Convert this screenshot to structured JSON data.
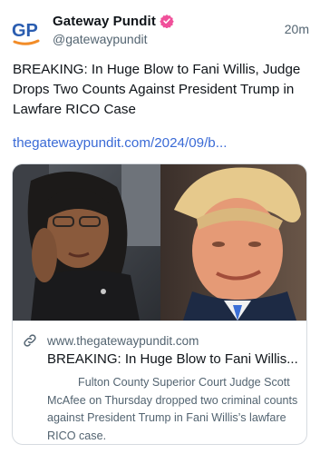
{
  "post": {
    "author_name": "Gateway Pundit",
    "author_handle": "@gatewaypundit",
    "avatar_text": "GP",
    "timestamp": "20m",
    "text": "BREAKING: In Huge Blow to Fani Willis, Judge Drops Two Counts Against President Trump in Lawfare RICO Case",
    "link_text": "thegatewaypundit.com/2024/09/b..."
  },
  "card": {
    "domain": "www.thegatewaypundit.com",
    "title": "BREAKING: In Huge Blow to Fani Willis...",
    "description": "Fulton County Superior Court Judge Scott McAfee on Thursday dropped two criminal counts against President Trump in Fani Willis’s lawfare RICO case."
  },
  "colors": {
    "link": "#3b6bd6",
    "verified_badge": "#f0509a",
    "avatar_blue": "#2a5db0",
    "avatar_orange": "#f28c28",
    "secondary_text": "#536471"
  },
  "icons": {
    "verified": "verified-badge-icon",
    "link": "link-icon",
    "avatar": "gp-logo-icon"
  }
}
